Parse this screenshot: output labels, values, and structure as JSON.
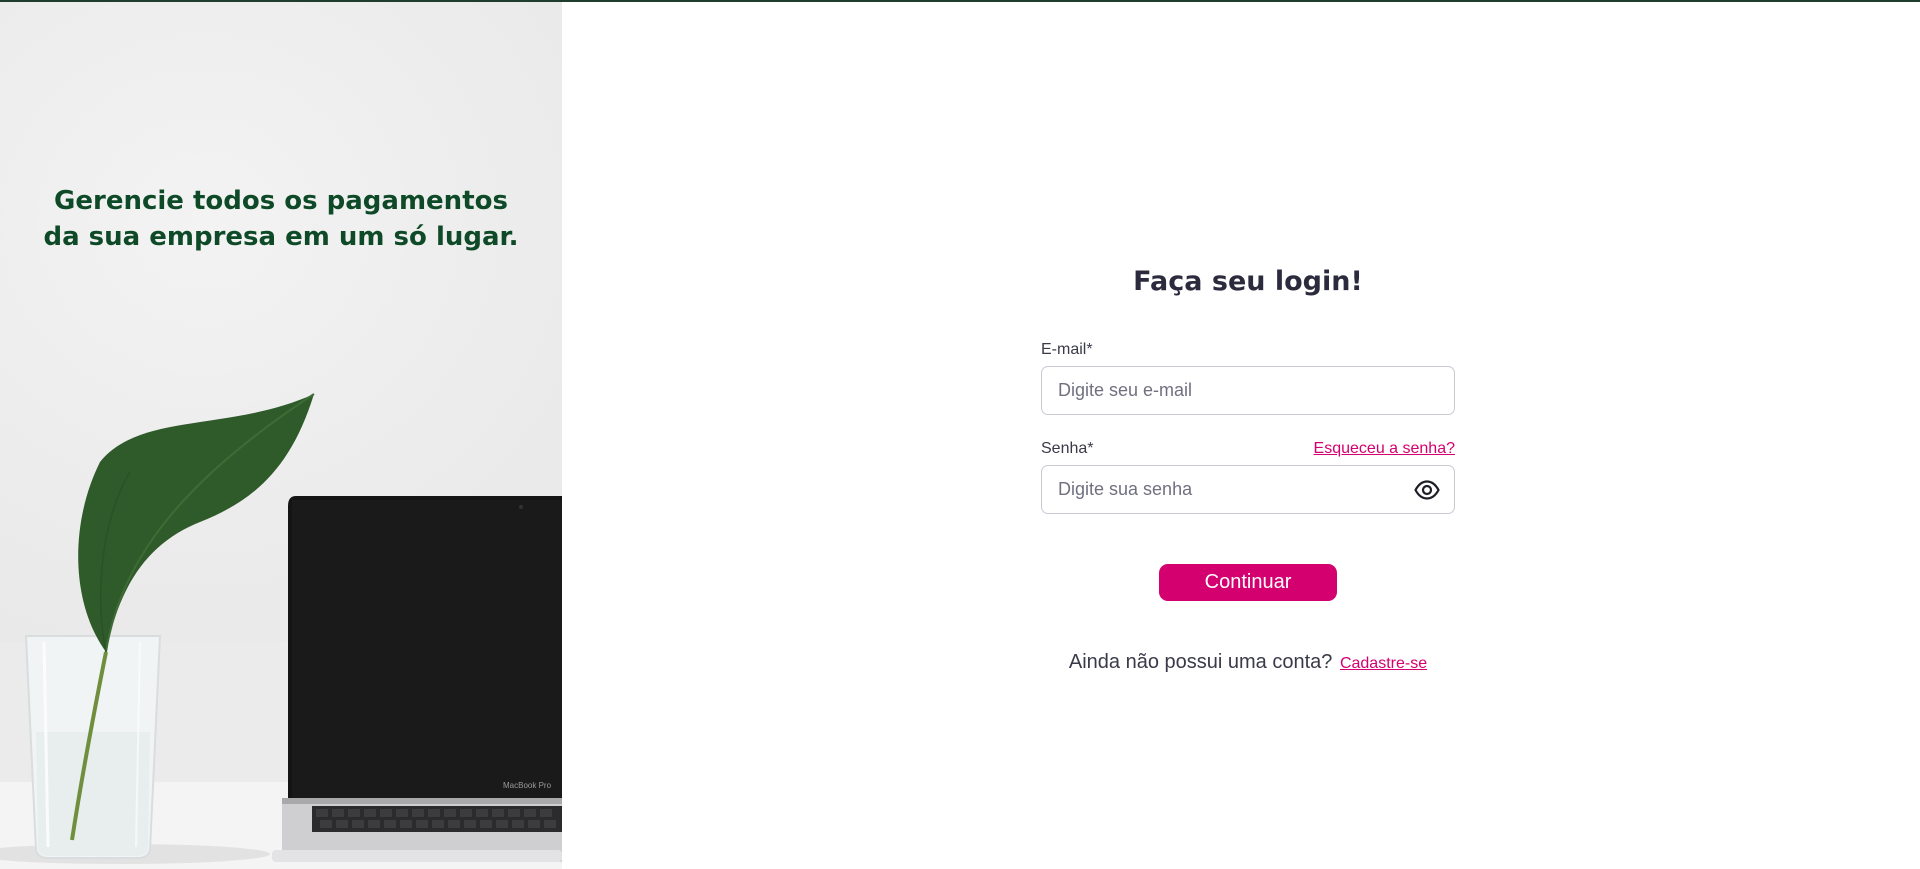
{
  "hero": {
    "headline": "Gerencie todos os pagamentos da sua empresa em um só lugar.",
    "laptop_brand": "MacBook Pro"
  },
  "login": {
    "title": "Faça seu login!",
    "email": {
      "label": "E-mail*",
      "placeholder": "Digite seu e-mail",
      "value": ""
    },
    "password": {
      "label": "Senha*",
      "placeholder": "Digite sua senha",
      "value": "",
      "forgot_label": "Esqueceu a senha?",
      "toggle_icon": "eye-icon"
    },
    "continue_label": "Continuar",
    "signup_prompt": "Ainda não possui uma conta?",
    "signup_link": "Cadastre-se"
  },
  "colors": {
    "brand_pink": "#d4006f",
    "hero_green": "#0e4a27",
    "text_dark": "#2b2b3d"
  }
}
